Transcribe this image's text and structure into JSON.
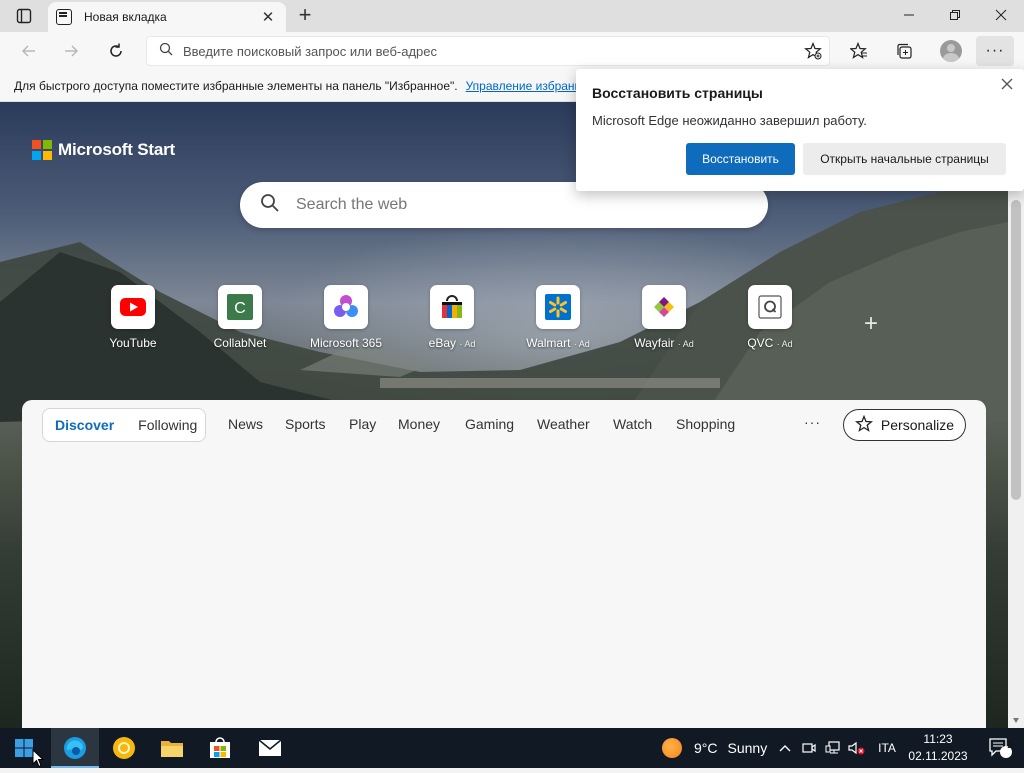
{
  "browser": {
    "tab": {
      "title": "Новая вкладка"
    },
    "address_bar": {
      "placeholder": "Введите поисковый запрос или веб-адрес"
    },
    "favorites_bar": {
      "message": "Для быстрого доступа поместите избранные элементы на панель \"Избранное\".",
      "link": "Управление избранным"
    }
  },
  "restore_popup": {
    "title": "Восстановить страницы",
    "message": "Microsoft Edge неожиданно завершил работу.",
    "restore_button": "Восстановить",
    "open_start_button": "Открыть начальные страницы"
  },
  "start_page": {
    "brand": "Microsoft Start",
    "search_placeholder": "Search the web",
    "quick_links": [
      {
        "label": "YouTube",
        "ad": ""
      },
      {
        "label": "CollabNet",
        "ad": ""
      },
      {
        "label": "Microsoft 365",
        "ad": ""
      },
      {
        "label": "eBay",
        "ad": "· Ad"
      },
      {
        "label": "Walmart",
        "ad": "· Ad"
      },
      {
        "label": "Wayfair",
        "ad": "· Ad"
      },
      {
        "label": "QVC",
        "ad": "· Ad"
      }
    ],
    "feed": {
      "tabs": [
        "Discover",
        "Following"
      ],
      "categories": [
        "News",
        "Sports",
        "Play",
        "Money",
        "Gaming",
        "Weather",
        "Watch",
        "Shopping"
      ],
      "more": "···",
      "personalize": "Personalize"
    }
  },
  "taskbar": {
    "weather": {
      "temp": "9°C",
      "condition": "Sunny"
    },
    "language": "ITA",
    "time": "11:23",
    "date": "02.11.2023",
    "notifications_count": "2"
  },
  "colors": {
    "accent": "#0f6cbd",
    "taskbar": "#111a24"
  }
}
